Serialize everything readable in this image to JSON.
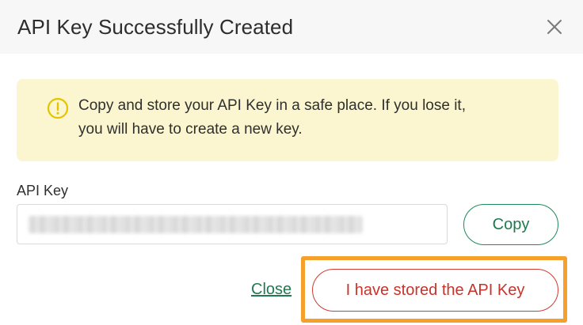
{
  "dialog": {
    "title": "API Key Successfully Created",
    "close_icon": "close-icon"
  },
  "alert": {
    "icon": "warning-circle-icon",
    "color": "#fbf6cf",
    "icon_color": "#e2c400",
    "line1": "Copy and store your API Key in a safe place. If you lose it,",
    "line2": "you will have to create a new key."
  },
  "api_key": {
    "label": "API Key",
    "value_state": "blurred"
  },
  "actions": {
    "copy_label": "Copy",
    "close_label": "Close",
    "stored_label": "I have stored the API Key",
    "highlight_color": "#f5a02a",
    "primary_color": "#1f7a50",
    "danger_color": "#c8332a"
  }
}
